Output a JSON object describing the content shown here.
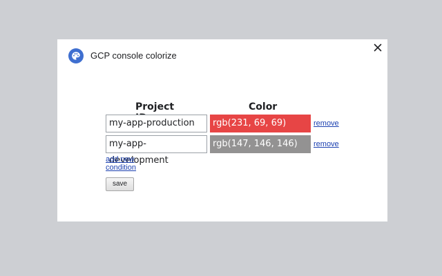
{
  "app": {
    "title": "GCP console colorize",
    "logo_icon": "palette-icon",
    "close_icon": "close-icon"
  },
  "table": {
    "headers": [
      "Project ID",
      "Color"
    ],
    "rows": [
      {
        "project_id": "my-app-production",
        "color": "rgb(231, 69, 69)",
        "remove_label": "remove"
      },
      {
        "project_id": "my-app-development",
        "color": "rgb(147, 146, 146)",
        "remove_label": "remove"
      }
    ]
  },
  "actions": {
    "add_label": "add new condition",
    "save_label": "save"
  },
  "colors": {
    "page_background": "#cdcfd3",
    "dialog_background": "#ffffff",
    "logo_blue": "#3f6fd0",
    "link": "#1a3fb0"
  }
}
